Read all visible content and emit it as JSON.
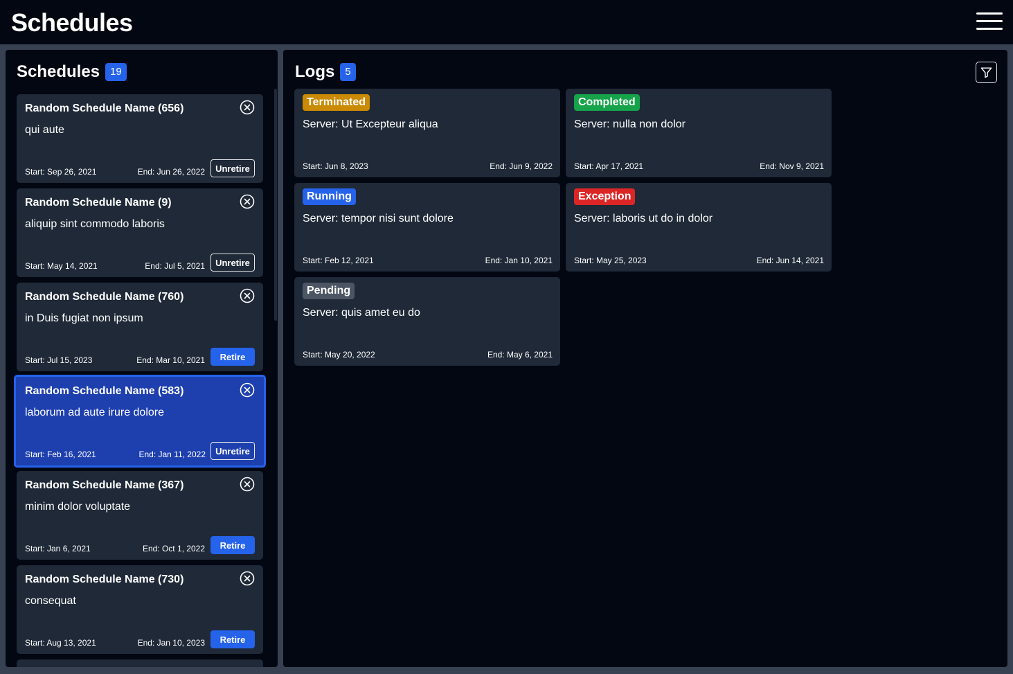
{
  "app": {
    "title": "Schedules",
    "menu_icon": "hamburger-menu-icon"
  },
  "schedules_panel": {
    "title": "Schedules",
    "count": "19",
    "items": [
      {
        "name": "Random Schedule Name (656)",
        "description": "qui aute",
        "start": "Start: Sep 26, 2021",
        "end": "End: Jun 26, 2022",
        "action": "Unretire",
        "selected": false
      },
      {
        "name": "Random Schedule Name (9)",
        "description": "aliquip sint commodo laboris",
        "start": "Start: May 14, 2021",
        "end": "End: Jul 5, 2021",
        "action": "Unretire",
        "selected": false
      },
      {
        "name": "Random Schedule Name (760)",
        "description": "in Duis fugiat non ipsum",
        "start": "Start: Jul 15, 2023",
        "end": "End: Mar 10, 2021",
        "action": "Retire",
        "selected": false
      },
      {
        "name": "Random Schedule Name (583)",
        "description": "laborum ad aute irure dolore",
        "start": "Start: Feb 16, 2021",
        "end": "End: Jan 11, 2022",
        "action": "Unretire",
        "selected": true
      },
      {
        "name": "Random Schedule Name (367)",
        "description": "minim dolor voluptate",
        "start": "Start: Jan 6, 2021",
        "end": "End: Oct 1, 2022",
        "action": "Retire",
        "selected": false
      },
      {
        "name": "Random Schedule Name (730)",
        "description": "consequat",
        "start": "Start: Aug 13, 2021",
        "end": "End: Jan 10, 2023",
        "action": "Retire",
        "selected": false
      }
    ]
  },
  "logs_panel": {
    "title": "Logs",
    "count": "5",
    "filter_icon": "filter-icon",
    "items": [
      {
        "status": "Terminated",
        "status_color": "#ca8a04",
        "server": "Server: Ut Excepteur aliqua",
        "start": "Start: Jun 8, 2023",
        "end": "End: Jun 9, 2022"
      },
      {
        "status": "Completed",
        "status_color": "#16a34a",
        "server": "Server: nulla non dolor",
        "start": "Start: Apr 17, 2021",
        "end": "End: Nov 9, 2021"
      },
      {
        "status": "Running",
        "status_color": "#2563eb",
        "server": "Server: tempor nisi sunt dolore",
        "start": "Start: Feb 12, 2021",
        "end": "End: Jan 10, 2021"
      },
      {
        "status": "Exception",
        "status_color": "#dc2626",
        "server": "Server: laboris ut do in dolor",
        "start": "Start: May 25, 2023",
        "end": "End: Jun 14, 2021"
      },
      {
        "status": "Pending",
        "status_color": "#4b5563",
        "server": "Server: quis amet eu do",
        "start": "Start: May 20, 2022",
        "end": "End: May 6, 2021"
      }
    ]
  }
}
